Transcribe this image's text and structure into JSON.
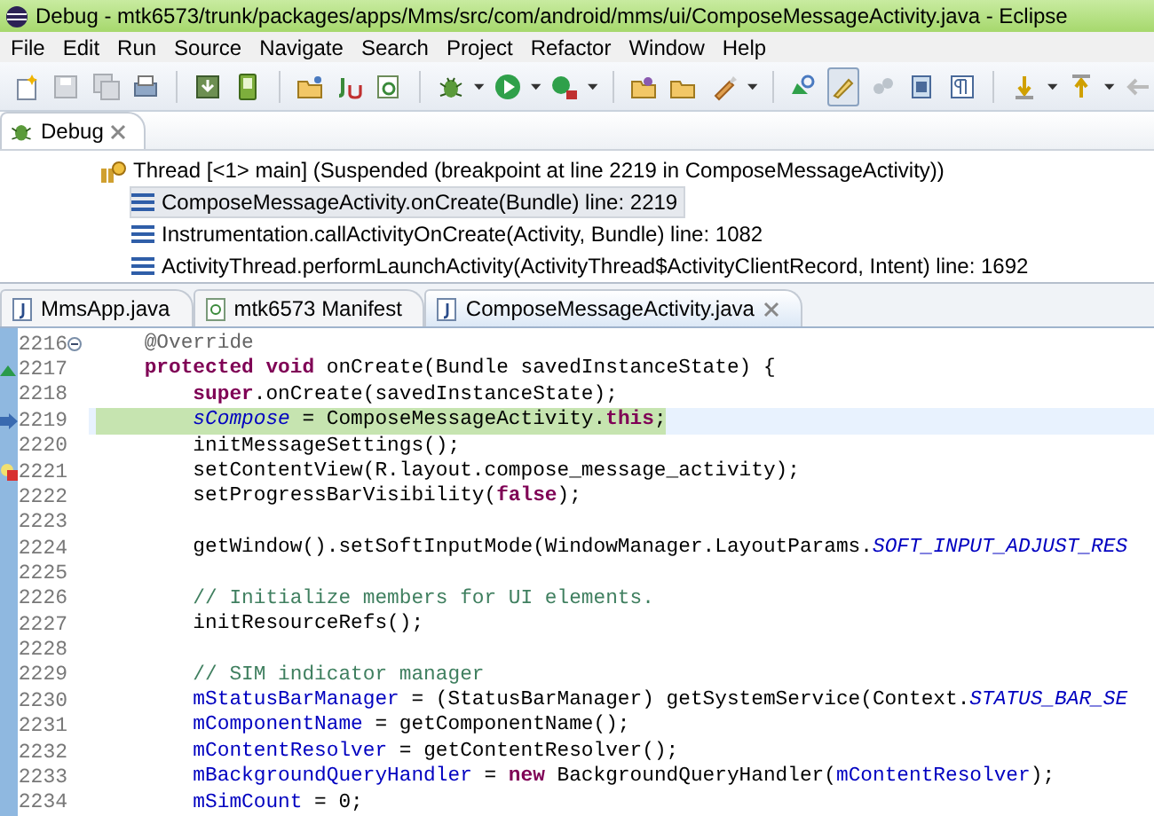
{
  "window": {
    "title": "Debug - mtk6573/trunk/packages/apps/Mms/src/com/android/mms/ui/ComposeMessageActivity.java - Eclipse"
  },
  "menu": [
    "File",
    "Edit",
    "Run",
    "Source",
    "Navigate",
    "Search",
    "Project",
    "Refactor",
    "Window",
    "Help"
  ],
  "debug_view": {
    "tab": {
      "label": "Debug",
      "selected": true
    },
    "thread": "Thread [<1> main] (Suspended (breakpoint at line 2219 in ComposeMessageActivity))",
    "frames": [
      {
        "label": "ComposeMessageActivity.onCreate(Bundle) line: 2219",
        "selected": true
      },
      {
        "label": "Instrumentation.callActivityOnCreate(Activity, Bundle) line: 1082",
        "selected": false
      },
      {
        "label": "ActivityThread.performLaunchActivity(ActivityThread$ActivityClientRecord, Intent) line: 1692",
        "selected": false
      }
    ]
  },
  "editor_tabs": [
    {
      "label": "MmsApp.java",
      "kind": "java",
      "selected": false
    },
    {
      "label": "mtk6573 Manifest",
      "kind": "manifest",
      "selected": false
    },
    {
      "label": "ComposeMessageActivity.java",
      "kind": "java",
      "selected": true
    }
  ],
  "code": [
    {
      "number": "2216",
      "kind": "fold",
      "current": false,
      "tokens": [
        {
          "kind": "annotation",
          "text": "    @Override"
        }
      ]
    },
    {
      "number": "2217",
      "kind": "override",
      "current": false,
      "tokens": [
        {
          "kind": "keyword",
          "text": "    protected void "
        },
        {
          "kind": "plain",
          "text": "onCreate(Bundle savedInstanceState) {"
        }
      ]
    },
    {
      "number": "2218",
      "kind": "plain",
      "current": false,
      "tokens": [
        {
          "kind": "keyword",
          "text": "        super"
        },
        {
          "kind": "plain",
          "text": ".onCreate(savedInstanceState);"
        }
      ]
    },
    {
      "number": "2219",
      "kind": "pointer",
      "current": true,
      "tokens": [
        {
          "kind": "static",
          "text": "        sCompose"
        },
        {
          "kind": "plain",
          "text": " = ComposeMessageActivity."
        },
        {
          "kind": "keyword",
          "text": "this"
        },
        {
          "kind": "plain",
          "text": ";"
        }
      ]
    },
    {
      "number": "2220",
      "kind": "plain",
      "current": false,
      "tokens": [
        {
          "kind": "plain",
          "text": "        initMessageSettings();"
        }
      ]
    },
    {
      "number": "2221",
      "kind": "error",
      "current": false,
      "tokens": [
        {
          "kind": "plain",
          "text": "        setContentView(R.layout.compose_message_activity);"
        }
      ]
    },
    {
      "number": "2222",
      "kind": "plain",
      "current": false,
      "tokens": [
        {
          "kind": "plain",
          "text": "        setProgressBarVisibility("
        },
        {
          "kind": "keyword",
          "text": "false"
        },
        {
          "kind": "plain",
          "text": ");"
        }
      ]
    },
    {
      "number": "2223",
      "kind": "plain",
      "current": false
    },
    {
      "number": "2224",
      "kind": "plain",
      "current": false,
      "tokens": [
        {
          "kind": "plain",
          "text": "        getWindow().setSoftInputMode(WindowManager.LayoutParams."
        },
        {
          "kind": "static",
          "text": "SOFT_INPUT_ADJUST_RES"
        }
      ]
    },
    {
      "number": "2225",
      "kind": "plain",
      "current": false
    },
    {
      "number": "2226",
      "kind": "plain",
      "current": false,
      "tokens": [
        {
          "kind": "comment",
          "text": "        // Initialize members for UI elements."
        }
      ]
    },
    {
      "number": "2227",
      "kind": "plain",
      "current": false,
      "tokens": [
        {
          "kind": "plain",
          "text": "        initResourceRefs();"
        }
      ]
    },
    {
      "number": "2228",
      "kind": "plain",
      "current": false
    },
    {
      "number": "2229",
      "kind": "plain",
      "current": false,
      "tokens": [
        {
          "kind": "comment",
          "text": "        // SIM indicator manager"
        }
      ]
    },
    {
      "number": "2230",
      "kind": "plain",
      "current": false,
      "tokens": [
        {
          "kind": "field",
          "text": "        mStatusBarManager"
        },
        {
          "kind": "plain",
          "text": " = (StatusBarManager) getSystemService(Context."
        },
        {
          "kind": "static",
          "text": "STATUS_BAR_SE"
        }
      ]
    },
    {
      "number": "2231",
      "kind": "plain",
      "current": false,
      "tokens": [
        {
          "kind": "field",
          "text": "        mComponentName"
        },
        {
          "kind": "plain",
          "text": " = getComponentName();"
        }
      ]
    },
    {
      "number": "2232",
      "kind": "plain",
      "current": false,
      "tokens": [
        {
          "kind": "field",
          "text": "        mContentResolver"
        },
        {
          "kind": "plain",
          "text": " = getContentResolver();"
        }
      ]
    },
    {
      "number": "2233",
      "kind": "plain",
      "current": false,
      "tokens": [
        {
          "kind": "field",
          "text": "        mBackgroundQueryHandler"
        },
        {
          "kind": "plain",
          "text": " = "
        },
        {
          "kind": "keyword",
          "text": "new "
        },
        {
          "kind": "plain",
          "text": "BackgroundQueryHandler("
        },
        {
          "kind": "field",
          "text": "mContentResolver"
        },
        {
          "kind": "plain",
          "text": ");"
        }
      ]
    },
    {
      "number": "2234",
      "kind": "plain",
      "current": false,
      "tokens": [
        {
          "kind": "field",
          "text": "        mSimCount"
        },
        {
          "kind": "plain",
          "text": " = 0;"
        }
      ]
    }
  ]
}
